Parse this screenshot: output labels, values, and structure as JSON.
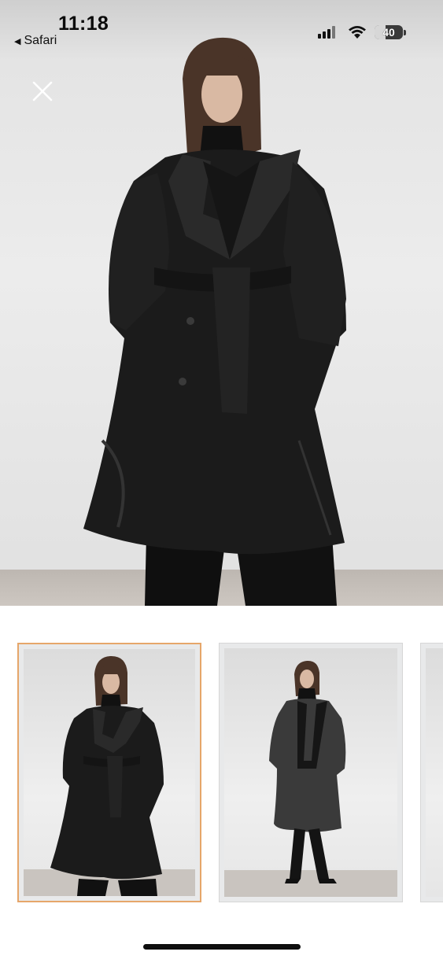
{
  "status_bar": {
    "time": "11:18",
    "back_label": "Safari",
    "back_icon": "triangle-left-icon",
    "signal_icon": "cellular-signal-icon",
    "wifi_icon": "wifi-icon",
    "battery_level": "40"
  },
  "viewer": {
    "close_icon": "close-icon",
    "main_image": "trench-coat-photo",
    "thumbnails": [
      {
        "name": "thumbnail-1",
        "selected": true
      },
      {
        "name": "thumbnail-2",
        "selected": false
      },
      {
        "name": "thumbnail-3",
        "selected": false
      }
    ],
    "accent_color": "#e6a66a"
  }
}
